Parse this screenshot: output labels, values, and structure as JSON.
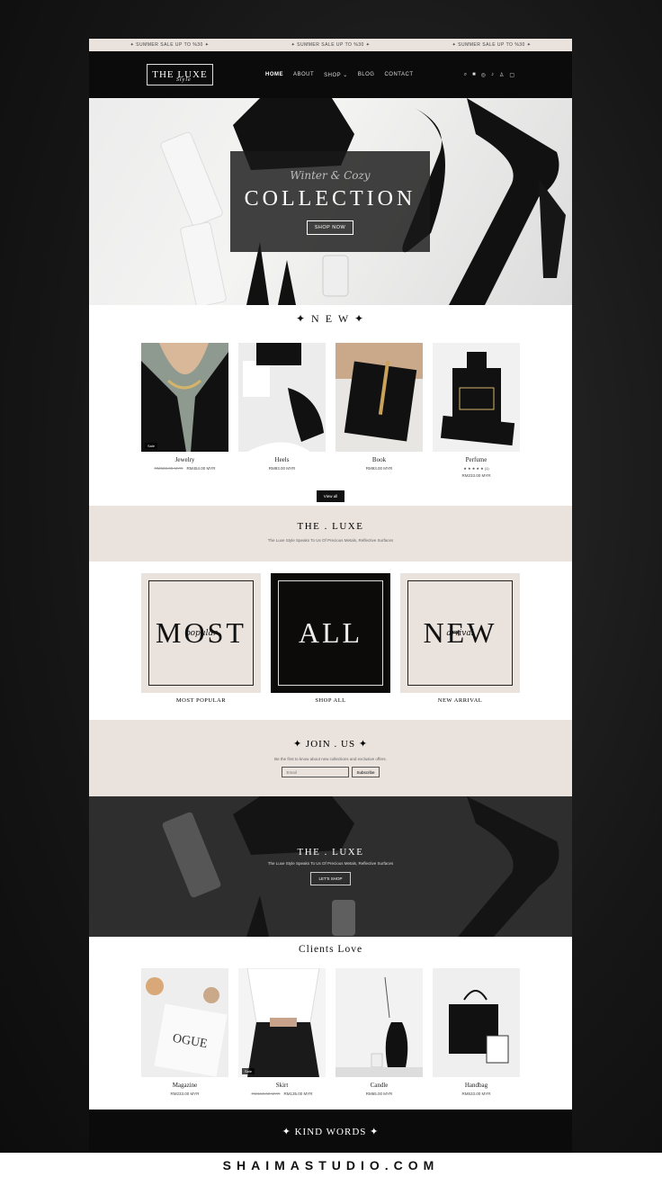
{
  "announcement": [
    "✦ SUMMER SALE UP TO %30 ✦",
    "✦ SUMMER SALE UP TO %30 ✦",
    "✦ SUMMER SALE UP TO %30 ✦"
  ],
  "nav": {
    "logo_text": "THE LUXE",
    "logo_script": "Style",
    "items": [
      "HOME",
      "ABOUT",
      "SHOP",
      "BLOG",
      "CONTACT"
    ],
    "active": "HOME",
    "icons": [
      "search-icon",
      "facebook-icon",
      "instagram-icon",
      "tiktok-icon",
      "account-icon",
      "cart-icon"
    ]
  },
  "hero": {
    "script": "Winter & Cozy",
    "title": "COLLECTION",
    "button": "SHOP NOW"
  },
  "new_section": {
    "title": "✦ N E W ✦",
    "products": [
      {
        "name": "Jewelry",
        "old_price": "RM500.00 MYR",
        "price": "RM454.00 MYR",
        "badge": "Sale"
      },
      {
        "name": "Heels",
        "old_price": "",
        "price": "RM93.00 MYR",
        "badge": ""
      },
      {
        "name": "Book",
        "old_price": "",
        "price": "RM93.00 MYR",
        "badge": ""
      },
      {
        "name": "Perfume",
        "old_price": "",
        "price": "RM233.00 MYR",
        "badge": "",
        "rating": "★ ★ ★ ★ ★",
        "review_count": "(1)"
      }
    ],
    "view_all": "View all"
  },
  "brand_band": {
    "title": "THE . LUXE",
    "text": "The Luxe Style Speaks To Us Of Precious Metals, Reflective Surfaces"
  },
  "categories": [
    {
      "big": "MOST",
      "small": "popular",
      "label": "MOST POPULAR",
      "theme": "light"
    },
    {
      "big": "ALL",
      "small": "",
      "label": "SHOP ALL",
      "theme": "dark"
    },
    {
      "big": "NEW",
      "small": "arrival",
      "label": "NEW ARRIVAL",
      "theme": "light"
    }
  ],
  "join": {
    "title": "✦ JOIN . US ✦",
    "text": "Be the first to know about new collections and exclusive offers.",
    "email_placeholder": "Email",
    "button": "Subscribe"
  },
  "banner": {
    "title": "THE . LUXE",
    "text": "The Luxe Style Speaks To Us Of Precious Metals, Reflective Surfaces",
    "button": "LET'S SHOP"
  },
  "clients": {
    "title": "Clients Love",
    "products": [
      {
        "name": "Magazine",
        "old_price": "",
        "price": "RM233.00 MYR",
        "badge": ""
      },
      {
        "name": "Skirt",
        "old_price": "RM150.00 MYR",
        "price": "RM135.00 MYR",
        "badge": "Sale"
      },
      {
        "name": "Candle",
        "old_price": "",
        "price": "RM65.00 MYR",
        "badge": ""
      },
      {
        "name": "Handbag",
        "old_price": "",
        "price": "RM533.00 MYR",
        "badge": ""
      }
    ]
  },
  "kind_words": "✦ KIND WORDS ✦",
  "footer_brand": "SHAIMASTUDIO.COM",
  "colors": {
    "beige": "#e9e2dd",
    "black": "#0b0b0b",
    "white": "#ffffff"
  }
}
